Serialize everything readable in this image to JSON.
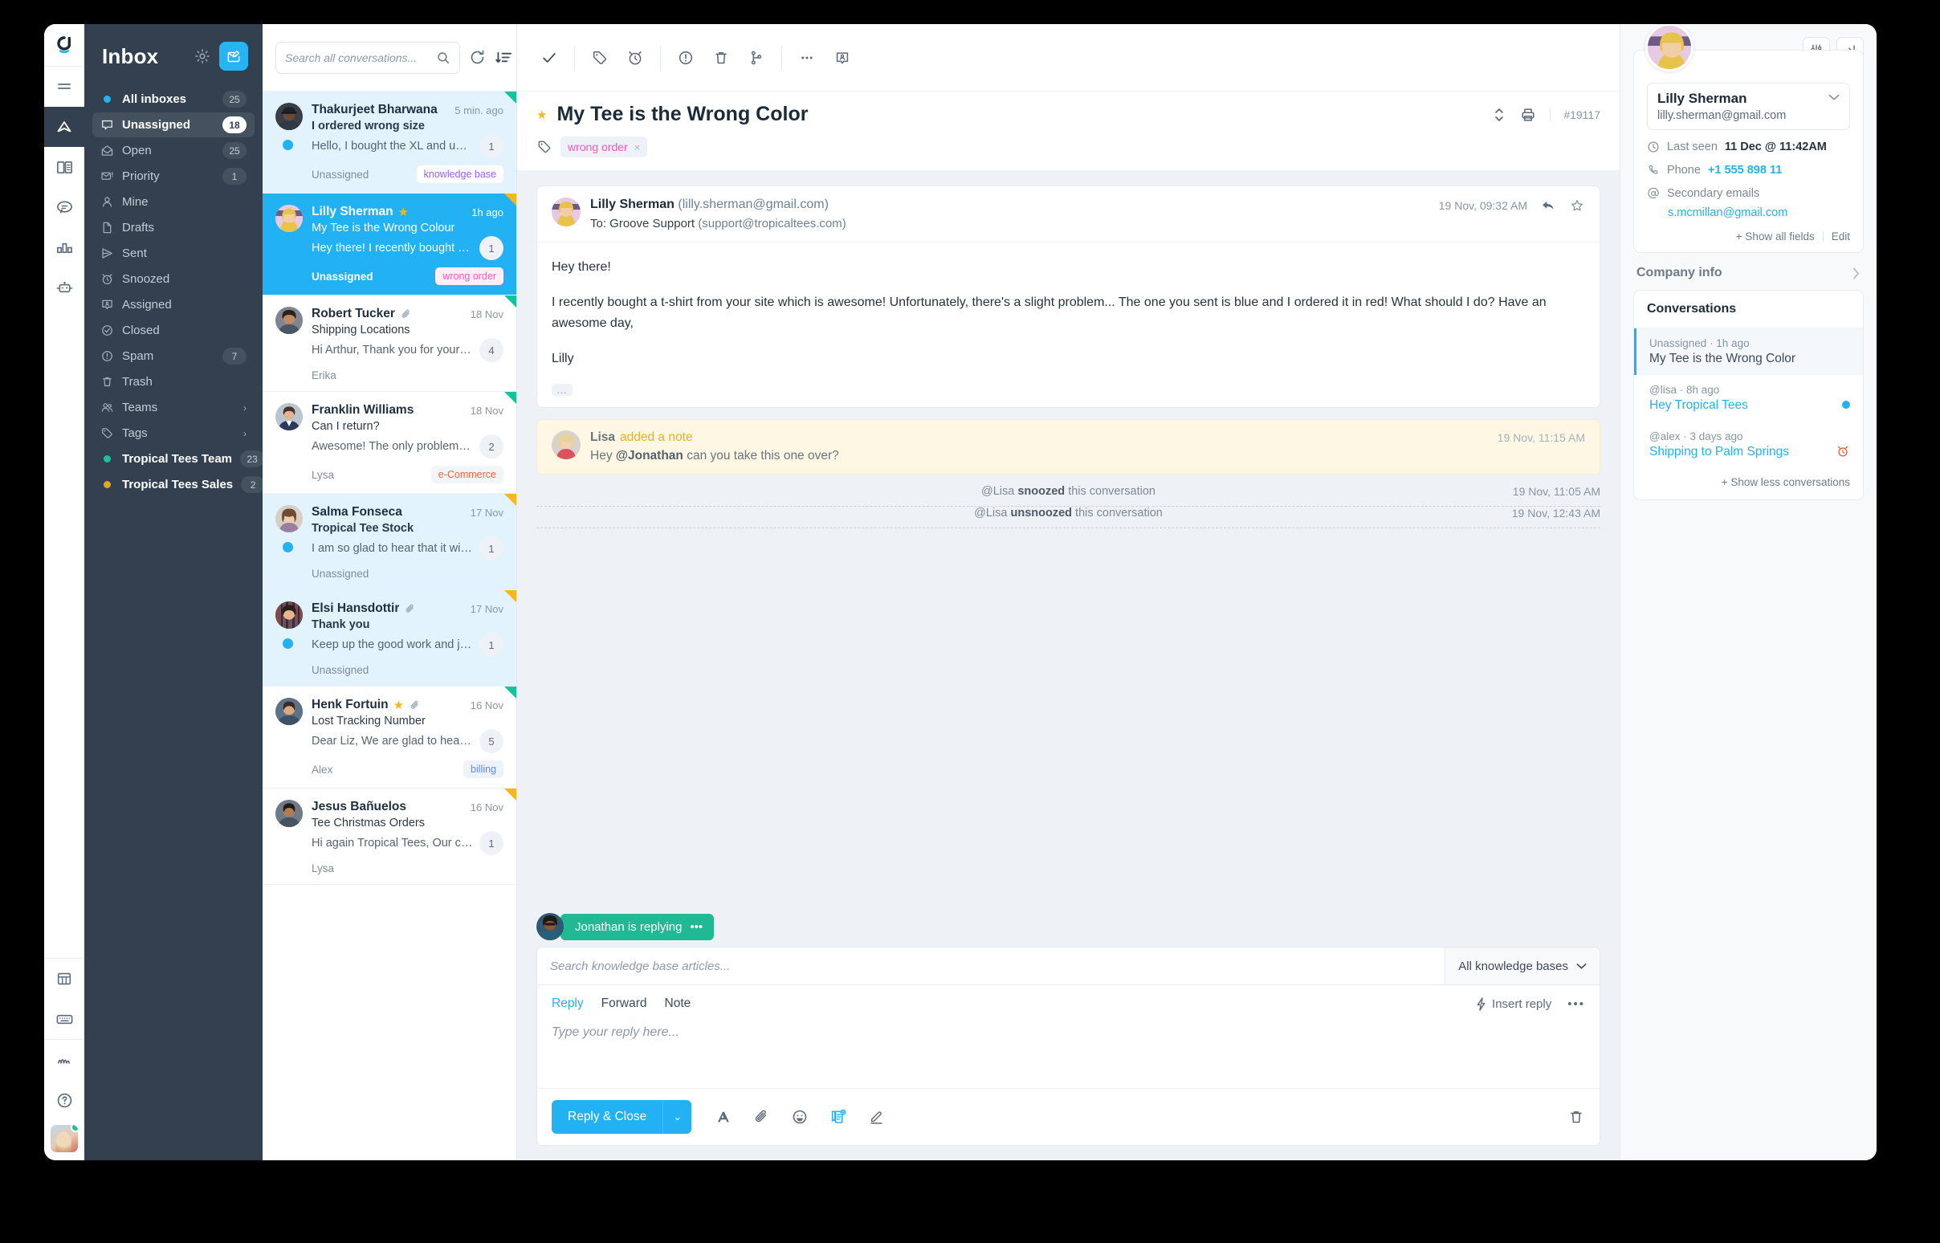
{
  "sidebar": {
    "title": "Inbox",
    "gear_icon": "gear-icon",
    "compose_icon": "compose-icon",
    "items": [
      {
        "label": "All inboxes",
        "count": "25",
        "icon": "dot-icon",
        "dot": "#22b2f4",
        "strong": true
      },
      {
        "label": "Unassigned",
        "count": "18",
        "icon": "chat-bubble-icon",
        "active": true
      },
      {
        "label": "Open",
        "count": "25",
        "icon": "open-envelope-icon"
      },
      {
        "label": "Priority",
        "count": "1",
        "icon": "priority-envelope-icon"
      },
      {
        "label": "Mine",
        "count": "",
        "icon": "person-icon"
      },
      {
        "label": "Drafts",
        "count": "",
        "icon": "file-icon"
      },
      {
        "label": "Sent",
        "count": "",
        "icon": "send-icon"
      },
      {
        "label": "Snoozed",
        "count": "",
        "icon": "alarm-icon"
      },
      {
        "label": "Assigned",
        "count": "",
        "icon": "assigned-icon"
      },
      {
        "label": "Closed",
        "count": "",
        "icon": "check-circle-icon"
      },
      {
        "label": "Spam",
        "count": "7",
        "icon": "alert-circle-icon"
      },
      {
        "label": "Trash",
        "count": "",
        "icon": "trash-icon"
      },
      {
        "label": "Teams",
        "count": "",
        "icon": "people-icon",
        "chevron": "›"
      },
      {
        "label": "Tags",
        "count": "",
        "icon": "tag-icon",
        "chevron": "›"
      },
      {
        "label": "Tropical Tees Team",
        "count": "23",
        "icon": "dot-icon",
        "dot": "#18c39a",
        "strong": true
      },
      {
        "label": "Tropical Tees Sales",
        "count": "2",
        "icon": "dot-icon",
        "dot": "#e0a822",
        "strong": true
      }
    ]
  },
  "conversation_list": {
    "search_placeholder": "Search all conversations...",
    "search_value": "",
    "refresh_icon": "refresh-icon",
    "sort_icon": "sort-icon",
    "items": [
      {
        "name": "Thakurjeet Bharwana",
        "time": "5 min. ago",
        "subject": "I ordered wrong size",
        "subject_bold": true,
        "preview": "Hello, I bought the XL and unfortuna...",
        "count": "1",
        "assignee": "Unassigned",
        "tag": "knowledge base",
        "tag_color": "#9b5cf6",
        "tag_bg": "#ffffff",
        "corner": "green",
        "unread": true,
        "newdot": true,
        "starred": false,
        "attachment": false,
        "selected": false
      },
      {
        "name": "Lilly Sherman",
        "time": "1h ago",
        "subject": "My Tee is the Wrong Colour",
        "subject_bold": false,
        "preview": "Hey there! I recently bought a tee-sh...",
        "count": "1",
        "assignee": "Unassigned",
        "tag": "wrong order",
        "tag_color": "#ff55c4",
        "tag_bg": "#fdeef8",
        "corner": "yellow",
        "unread": false,
        "newdot": false,
        "starred": true,
        "attachment": false,
        "selected": true
      },
      {
        "name": "Robert Tucker",
        "time": "18 Nov",
        "subject": "Shipping Locations",
        "subject_bold": false,
        "preview": "Hi Arthur, Thank you for your messa...",
        "count": "4",
        "assignee": "Erika",
        "tag": "",
        "tag_color": "",
        "tag_bg": "",
        "corner": "green",
        "unread": false,
        "newdot": false,
        "starred": false,
        "attachment": true,
        "selected": false
      },
      {
        "name": "Franklin Williams",
        "time": "18 Nov",
        "subject": "Can I return?",
        "subject_bold": false,
        "preview": "Awesome! The only problem I have i...",
        "count": "2",
        "assignee": "Lysa",
        "tag": "e-Commerce",
        "tag_color": "#f2643c",
        "tag_bg": "#f3f6f9",
        "corner": "green",
        "unread": false,
        "newdot": false,
        "starred": false,
        "attachment": false,
        "selected": false
      },
      {
        "name": "Salma Fonseca",
        "time": "17 Nov",
        "subject": "Tropical Tee Stock",
        "subject_bold": true,
        "preview": "I am so glad to hear that it will be ba...",
        "count": "1",
        "assignee": "Unassigned",
        "tag": "",
        "tag_color": "",
        "tag_bg": "",
        "corner": "yellow",
        "unread": true,
        "newdot": true,
        "starred": false,
        "attachment": false,
        "selected": false
      },
      {
        "name": "Elsi Hansdottir",
        "time": "17 Nov",
        "subject": "Thank you",
        "subject_bold": true,
        "preview": "Keep up the good work and just let...",
        "count": "1",
        "assignee": "Unassigned",
        "tag": "",
        "tag_color": "",
        "tag_bg": "",
        "corner": "yellow",
        "unread": true,
        "newdot": true,
        "starred": false,
        "attachment": true,
        "selected": false
      },
      {
        "name": "Henk Fortuin",
        "time": "16 Nov",
        "subject": "Lost Tracking Number",
        "subject_bold": false,
        "preview": "Dear Liz, We are glad to hear that yo...",
        "count": "5",
        "assignee": "Alex",
        "tag": "billing",
        "tag_color": "#5b8cf2",
        "tag_bg": "#eef2fb",
        "corner": "green",
        "unread": false,
        "newdot": false,
        "starred": true,
        "attachment": true,
        "selected": false
      },
      {
        "name": "Jesus Bañuelos",
        "time": "16 Nov",
        "subject": "Tee Christmas Orders",
        "subject_bold": false,
        "preview": "Hi again Tropical Tees, Our company...",
        "count": "1",
        "assignee": "Lysa",
        "tag": "",
        "tag_color": "",
        "tag_bg": "",
        "corner": "yellow",
        "unread": false,
        "newdot": false,
        "starred": false,
        "attachment": false,
        "selected": false
      }
    ]
  },
  "thread": {
    "toolbar_icons": [
      "check-icon",
      "tag-icon",
      "alarm-icon",
      "alert-circle-icon",
      "trash-icon",
      "merge-icon",
      "more-icon",
      "assign-icon"
    ],
    "subject": "My Tee is the Wrong Color",
    "starred": true,
    "id": "#19117",
    "nav_icon": "up-down-icon",
    "print_icon": "print-icon",
    "tag": "wrong order",
    "tag_remove": "×",
    "message": {
      "from_name": "Lilly Sherman",
      "from_email": "(lilly.sherman@gmail.com)",
      "to_label": "To: Groove Support",
      "to_email": "(support@tropicaltees.com)",
      "time": "19 Nov, 09:32 AM",
      "reply_icon": "reply-icon",
      "star_icon": "star-outline-icon",
      "p1": "Hey there!",
      "p2": "I recently bought a t-shirt from your site which is awesome! Unfortunately, there's a slight problem... The one you sent is blue and I ordered it in red! What should I do? Have an awesome day,",
      "p3": "Lilly",
      "more": "…"
    },
    "note": {
      "author": "Lisa",
      "action": "added a note",
      "time": "19 Nov, 11:15 AM",
      "text_pre": "Hey ",
      "text_mention": "@Jonathan",
      "text_post": " can you take this one over?"
    },
    "activities": [
      {
        "who": "@Lisa",
        "verb": "snoozed",
        "rest": "this conversation",
        "time": "19 Nov, 11:05 AM"
      },
      {
        "who": "@Lisa",
        "verb": "unsnoozed",
        "rest": "this conversation",
        "time": "19 Nov, 12:43 AM"
      }
    ],
    "typing": {
      "text": "Jonathan is replying",
      "dots": "•••"
    },
    "kb": {
      "placeholder": "Search knowledge base articles...",
      "value": "",
      "select_label": "All knowledge bases"
    },
    "composer": {
      "tabs": [
        "Reply",
        "Forward",
        "Note"
      ],
      "active_tab": "Reply",
      "insert_reply": "Insert reply",
      "more": "•••",
      "placeholder": "Type your reply here...",
      "value": "",
      "send_label": "Reply & Close",
      "caret": "⌄",
      "icons": [
        "format-text-icon",
        "attachment-icon",
        "emoji-icon",
        "knowledge-base-icon",
        "signature-icon"
      ],
      "trash_icon": "trash-icon"
    }
  },
  "right_panel": {
    "settings_icon": "sliders-icon",
    "collapse_icon": "collapse-panel-icon",
    "customer": {
      "name": "Lilly Sherman",
      "email": "lilly.sherman@gmail.com",
      "chevron": "⌄",
      "last_seen_label": "Last seen",
      "last_seen_value": "11 Dec @ 11:42AM",
      "phone_label": "Phone",
      "phone_value": "+1 555 898 11",
      "secondary_label": "Secondary emails",
      "secondary_value": "s.mcmillan@gmail.com",
      "show_all": "+ Show all fields",
      "edit": "Edit"
    },
    "company_info": "Company info",
    "conversations_title": "Conversations",
    "conversations": [
      {
        "meta": "Unassigned · 1h ago",
        "title": "My Tee is the Wrong Color",
        "active": true,
        "link": false,
        "dot": false,
        "snooze": false
      },
      {
        "meta": "@lisa · 8h ago",
        "title": "Hey Tropical Tees",
        "active": false,
        "link": true,
        "dot": true,
        "snooze": false
      },
      {
        "meta": "@alex · 3 days ago",
        "title": "Shipping to Palm Springs",
        "active": false,
        "link": true,
        "dot": false,
        "snooze": true
      }
    ],
    "show_less": "+ Show less conversations"
  },
  "rail": {
    "logo_icon": "groove-logo-icon",
    "items": [
      {
        "icon": "menu-icon",
        "active": false
      },
      {
        "icon": "navigator-icon",
        "active": true
      },
      {
        "icon": "knowledge-book-icon",
        "active": false
      },
      {
        "icon": "chat-icon",
        "active": false
      },
      {
        "icon": "reports-icon",
        "active": false
      },
      {
        "icon": "bot-icon",
        "active": false
      }
    ],
    "bottom_items": [
      {
        "icon": "table-icon"
      },
      {
        "icon": "keyboard-icon"
      },
      {
        "icon": "activity-icon"
      },
      {
        "icon": "help-icon"
      }
    ],
    "avatar": "user-avatar"
  },
  "colors": {
    "accent": "#22b2f4",
    "sidebar_bg": "#33404f",
    "selected_conv": "#22b2f4",
    "unread_conv": "#e2f3fd",
    "note_bg": "#fdf7e4",
    "typing_green": "#21b894",
    "star_gold": "#f5b719"
  }
}
